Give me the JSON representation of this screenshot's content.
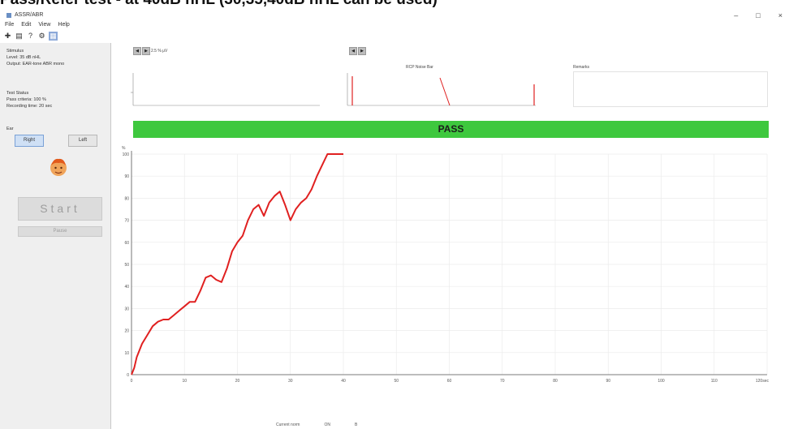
{
  "page": {
    "heading": "Pass/Refer test - at 40dB nHL (30,35,40dB nHL can be used)"
  },
  "window": {
    "title": "ASSR/ABR",
    "controls": [
      "–",
      "□",
      "×"
    ]
  },
  "menu": {
    "items": [
      "File",
      "Edit",
      "View",
      "Help"
    ]
  },
  "toolbar": {
    "icons": [
      "new-icon",
      "print-icon",
      "help-icon",
      "settings-icon",
      "chart-icon"
    ]
  },
  "stimulus": {
    "title": "Stimulus",
    "level": "Level: 35 dB nHL",
    "output": "Output: EAR-tone ABR mono"
  },
  "test_status": {
    "title": "Test Status",
    "pass_criteria": "Pass criteria:    100 %",
    "recording_time": "Recording time:  20 sec"
  },
  "ear": {
    "title": "Ear",
    "right": "Right",
    "left": "Left"
  },
  "buttons": {
    "start": "Start",
    "pause": "Pause"
  },
  "top": {
    "scale": "2.5 % μV",
    "noise_label": "RCP Noise Bar",
    "remarks_label": "Remarks"
  },
  "result": {
    "label": "PASS",
    "color": "#3ec83e"
  },
  "status_bar": {
    "label": "Current norm",
    "value1": "ON",
    "value2": "B"
  },
  "chart_data": {
    "type": "line",
    "title": "",
    "xlabel": "",
    "ylabel": "",
    "xlim": [
      0,
      120
    ],
    "ylim": [
      0,
      100
    ],
    "x_ticks": [
      0,
      10,
      20,
      30,
      40,
      50,
      60,
      70,
      80,
      90,
      100,
      110
    ],
    "x_tick_labels": [
      "0",
      "10",
      "20",
      "30",
      "40",
      "50",
      "60",
      "70",
      "80",
      "90",
      "100",
      "110"
    ],
    "y_ticks": [
      0,
      10,
      20,
      30,
      40,
      50,
      60,
      70,
      80,
      90,
      100
    ],
    "y_tick_labels": [
      "0",
      "10",
      "20",
      "30",
      "40",
      "50",
      "60",
      "70",
      "80",
      "90",
      "100"
    ],
    "x_axis_end_label": "120sec",
    "y_axis_top_label": "%",
    "grid": true,
    "line_color": "#e02020",
    "series": [
      {
        "points": [
          [
            0,
            0
          ],
          [
            0.5,
            3
          ],
          [
            1,
            8
          ],
          [
            2,
            14
          ],
          [
            3,
            18
          ],
          [
            4,
            22
          ],
          [
            5,
            24
          ],
          [
            6,
            25
          ],
          [
            7,
            25
          ],
          [
            8,
            27
          ],
          [
            9,
            29
          ],
          [
            10,
            31
          ],
          [
            11,
            33
          ],
          [
            12,
            33
          ],
          [
            13,
            38
          ],
          [
            14,
            44
          ],
          [
            15,
            45
          ],
          [
            16,
            43
          ],
          [
            17,
            42
          ],
          [
            18,
            48
          ],
          [
            19,
            56
          ],
          [
            20,
            60
          ],
          [
            21,
            63
          ],
          [
            22,
            70
          ],
          [
            23,
            75
          ],
          [
            24,
            77
          ],
          [
            25,
            72
          ],
          [
            26,
            78
          ],
          [
            27,
            81
          ],
          [
            28,
            83
          ],
          [
            29,
            77
          ],
          [
            30,
            70
          ],
          [
            31,
            75
          ],
          [
            32,
            78
          ],
          [
            33,
            80
          ],
          [
            34,
            84
          ],
          [
            35,
            90
          ],
          [
            36,
            95
          ],
          [
            37,
            100
          ],
          [
            40,
            100
          ]
        ]
      }
    ]
  }
}
